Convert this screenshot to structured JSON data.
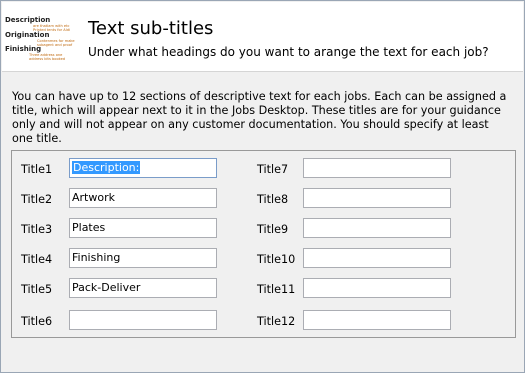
{
  "header": {
    "title": "Text sub-titles",
    "subtitle": "Under what headings do you want to arange the text for each job?",
    "logo": {
      "word1": "Description",
      "word2": "Origination",
      "word3": "Finishing",
      "small1": "are thatlam with etc",
      "small2": "Printed tents for Aldi",
      "small3": "Contenmes for make",
      "small4": "subagent and proof",
      "small5": "Three address one",
      "small6": "address bits booked"
    }
  },
  "intro": "You can have up to 12 sections of descriptive text for each jobs.  Each can be assigned a title, which will appear next to it in the Jobs Desktop. These titles are for your guidance only and will not appear on any customer documentation. You should specify at least one title.",
  "titles": [
    {
      "label": "Title1",
      "value": "Description:"
    },
    {
      "label": "Title2",
      "value": "Artwork"
    },
    {
      "label": "Title3",
      "value": "Plates"
    },
    {
      "label": "Title4",
      "value": "Finishing"
    },
    {
      "label": "Title5",
      "value": "Pack-Deliver"
    },
    {
      "label": "Title6",
      "value": ""
    },
    {
      "label": "Title7",
      "value": ""
    },
    {
      "label": "Title8",
      "value": ""
    },
    {
      "label": "Title9",
      "value": ""
    },
    {
      "label": "Title10",
      "value": ""
    },
    {
      "label": "Title11",
      "value": ""
    },
    {
      "label": "Title12",
      "value": ""
    }
  ],
  "colors": {
    "header_bg": "#ffffff",
    "panel_bg": "#f0f0f0",
    "field_border_focus": "#7a9cc9",
    "selection": "#3399ff",
    "logo_accent": "#c06a10"
  }
}
